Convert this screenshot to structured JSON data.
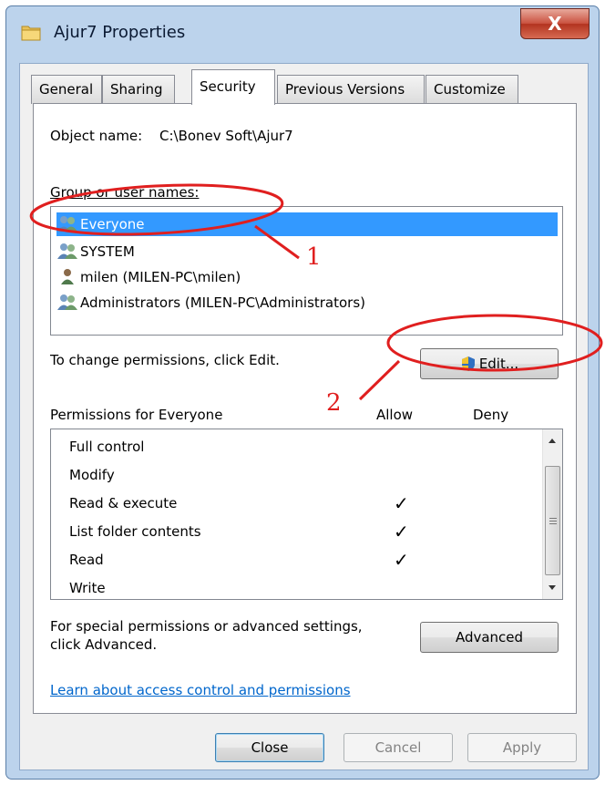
{
  "window": {
    "title": "Ajur7 Properties",
    "close_glyph": "X"
  },
  "tabs": [
    {
      "label": "General"
    },
    {
      "label": "Sharing"
    },
    {
      "label": "Security"
    },
    {
      "label": "Previous Versions"
    },
    {
      "label": "Customize"
    }
  ],
  "object": {
    "label": "Object name:",
    "value": "C:\\Bonev Soft\\Ajur7"
  },
  "groups": {
    "label": "Group or user names:",
    "items": [
      {
        "name": "Everyone"
      },
      {
        "name": "SYSTEM"
      },
      {
        "name": "milen (MILEN-PC\\milen)"
      },
      {
        "name": "Administrators (MILEN-PC\\Administrators)"
      }
    ]
  },
  "change_hint": "To change permissions, click Edit.",
  "edit_button": "Edit...",
  "permissions": {
    "label": "Permissions for Everyone",
    "allow_header": "Allow",
    "deny_header": "Deny",
    "rows": [
      {
        "name": "Full control",
        "allow": "",
        "deny": ""
      },
      {
        "name": "Modify",
        "allow": "",
        "deny": ""
      },
      {
        "name": "Read & execute",
        "allow": "✓",
        "deny": ""
      },
      {
        "name": "List folder contents",
        "allow": "✓",
        "deny": ""
      },
      {
        "name": "Read",
        "allow": "✓",
        "deny": ""
      },
      {
        "name": "Write",
        "allow": "",
        "deny": ""
      }
    ]
  },
  "advanced_hint": {
    "line1": "For special permissions or advanced settings,",
    "line2": "click Advanced."
  },
  "advanced_button": "Advanced",
  "learn_link": "Learn about access control and permissions",
  "footer": {
    "close": "Close",
    "cancel": "Cancel",
    "apply": "Apply"
  },
  "annotations": {
    "one": "1",
    "two": "2"
  },
  "colors": {
    "selection": "#3399ff",
    "annotation": "#e01f1f",
    "link": "#0066cc",
    "frame": "#bcd3ec"
  }
}
